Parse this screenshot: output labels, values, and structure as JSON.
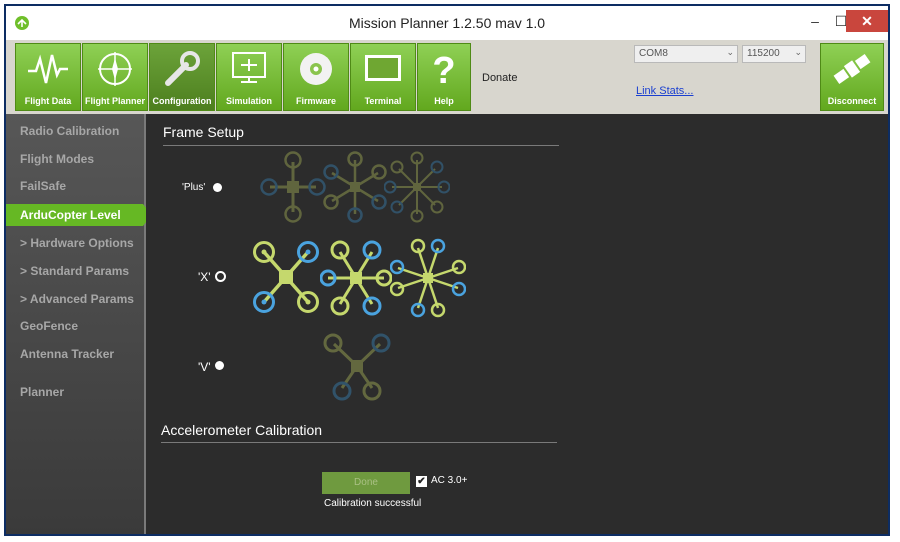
{
  "window": {
    "title": "Mission Planner 1.2.50 mav 1.0",
    "minimize_glyph": "–",
    "maximize_glyph": "☐",
    "close_glyph": "✕"
  },
  "toolbar": {
    "buttons": [
      {
        "label": "Flight Data",
        "icon": "heartbeat-icon"
      },
      {
        "label": "Flight Planner",
        "icon": "compass-icon"
      },
      {
        "label": "Configuration",
        "icon": "wrench-icon"
      },
      {
        "label": "Simulation",
        "icon": "monitor-plane-icon"
      },
      {
        "label": "Firmware",
        "icon": "disc-icon"
      },
      {
        "label": "Terminal",
        "icon": "terminal-icon"
      },
      {
        "label": "Help",
        "icon": "question-icon"
      }
    ],
    "donate_label": "Donate",
    "port": "COM8",
    "baud": "115200",
    "link_stats": "Link Stats...",
    "disconnect_label": "Disconnect",
    "accent": "#66b824"
  },
  "sidebar": {
    "items": [
      {
        "label": "Radio Calibration"
      },
      {
        "label": "Flight Modes"
      },
      {
        "label": "FailSafe"
      },
      {
        "label": "ArduCopter Level"
      },
      {
        "label": "> Hardware Options"
      },
      {
        "label": "> Standard Params"
      },
      {
        "label": "> Advanced Params"
      },
      {
        "label": "GeoFence"
      },
      {
        "label": "Antenna Tracker"
      },
      {
        "label": "Planner"
      }
    ],
    "active_index": 3
  },
  "frame_setup": {
    "title": "Frame Setup",
    "options": [
      {
        "label": "'Plus'",
        "selected": false
      },
      {
        "label": "'X'",
        "selected": true
      },
      {
        "label": "'V'",
        "selected": false
      }
    ]
  },
  "accel_calibration": {
    "title": "Accelerometer Calibration",
    "done_button": "Done",
    "checkbox_label": "AC 3.0+",
    "checkbox_checked": true,
    "status": "Calibration successful"
  },
  "colors": {
    "yellow_green": "#c5d86d",
    "blue": "#4aa3df",
    "panel_bg": "#2c2c2c"
  }
}
